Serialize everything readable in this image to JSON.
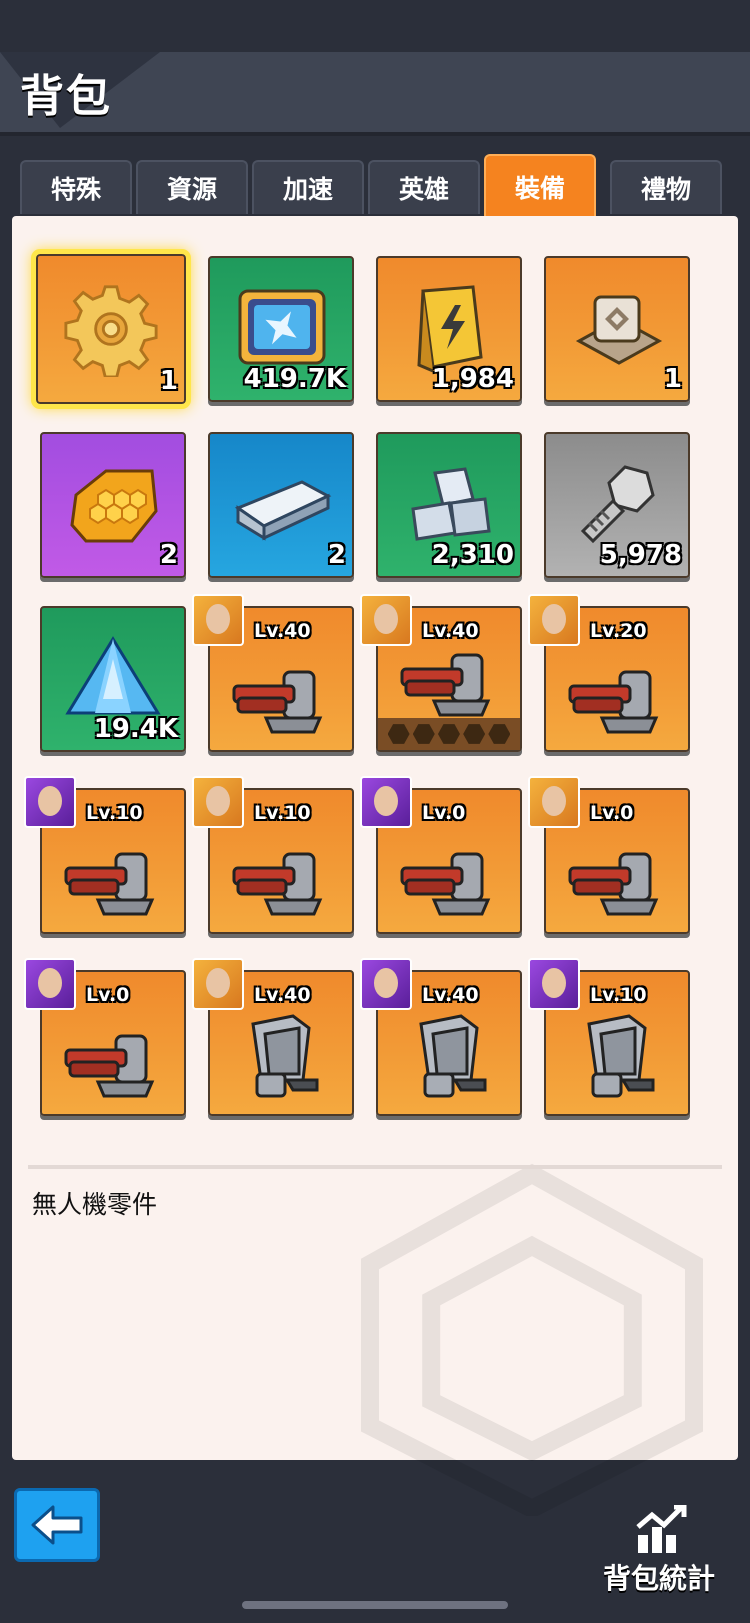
{
  "header": {
    "title": "背包"
  },
  "tabs": [
    {
      "label": "特殊",
      "active": false
    },
    {
      "label": "資源",
      "active": false
    },
    {
      "label": "加速",
      "active": false
    },
    {
      "label": "英雄",
      "active": false
    },
    {
      "label": "裝備",
      "active": true
    },
    {
      "label": "禮物",
      "active": false
    }
  ],
  "items": [
    {
      "icon": "gear-icon",
      "bg": "orange",
      "qty": "1",
      "selected": true
    },
    {
      "icon": "plane-card-icon",
      "bg": "green",
      "qty": "419.7K"
    },
    {
      "icon": "lightning-book-icon",
      "bg": "orange",
      "qty": "1,984"
    },
    {
      "icon": "chip-device-icon",
      "bg": "orange",
      "qty": "1"
    },
    {
      "icon": "honeycomb-plate-icon",
      "bg": "purple",
      "qty": "2"
    },
    {
      "icon": "steel-bar-icon",
      "bg": "blue",
      "qty": "2"
    },
    {
      "icon": "metal-blocks-icon",
      "bg": "green",
      "qty": "2,310"
    },
    {
      "icon": "bolt-screw-icon",
      "bg": "gray",
      "qty": "5,978"
    },
    {
      "icon": "blue-crystal-icon",
      "bg": "green",
      "qty": "19.4K"
    },
    {
      "icon": "turret-icon",
      "bg": "orange",
      "level": "Lv.40",
      "avatar": "orange"
    },
    {
      "icon": "turret-icon",
      "bg": "orange",
      "level": "Lv.40",
      "avatar": "orange",
      "hexbar": true
    },
    {
      "icon": "turret-icon",
      "bg": "orange",
      "level": "Lv.20",
      "avatar": "orange"
    },
    {
      "icon": "turret-icon",
      "bg": "orange",
      "level": "Lv.10",
      "avatar": "purple"
    },
    {
      "icon": "turret-icon",
      "bg": "orange",
      "level": "Lv.10",
      "avatar": "orange"
    },
    {
      "icon": "turret-icon",
      "bg": "orange",
      "level": "Lv.0",
      "avatar": "purple"
    },
    {
      "icon": "turret-icon",
      "bg": "orange",
      "level": "Lv.0",
      "avatar": "orange"
    },
    {
      "icon": "turret-icon",
      "bg": "orange",
      "level": "Lv.0",
      "avatar": "purple"
    },
    {
      "icon": "armor-plate-icon",
      "bg": "orange",
      "level": "Lv.40",
      "avatar": "orange"
    },
    {
      "icon": "armor-plate-icon",
      "bg": "orange",
      "level": "Lv.40",
      "avatar": "purple"
    },
    {
      "icon": "armor-plate-icon",
      "bg": "orange",
      "level": "Lv.10",
      "avatar": "purple"
    }
  ],
  "description": "無人機零件",
  "footer": {
    "back_icon": "back-arrow-icon",
    "stats_label": "背包統計",
    "stats_icon": "bar-chart-icon"
  },
  "colors": {
    "accent": "#f5831f",
    "panel": "#fbf2ee",
    "background": "#2b2f3a",
    "selected": "#ffe64a"
  }
}
